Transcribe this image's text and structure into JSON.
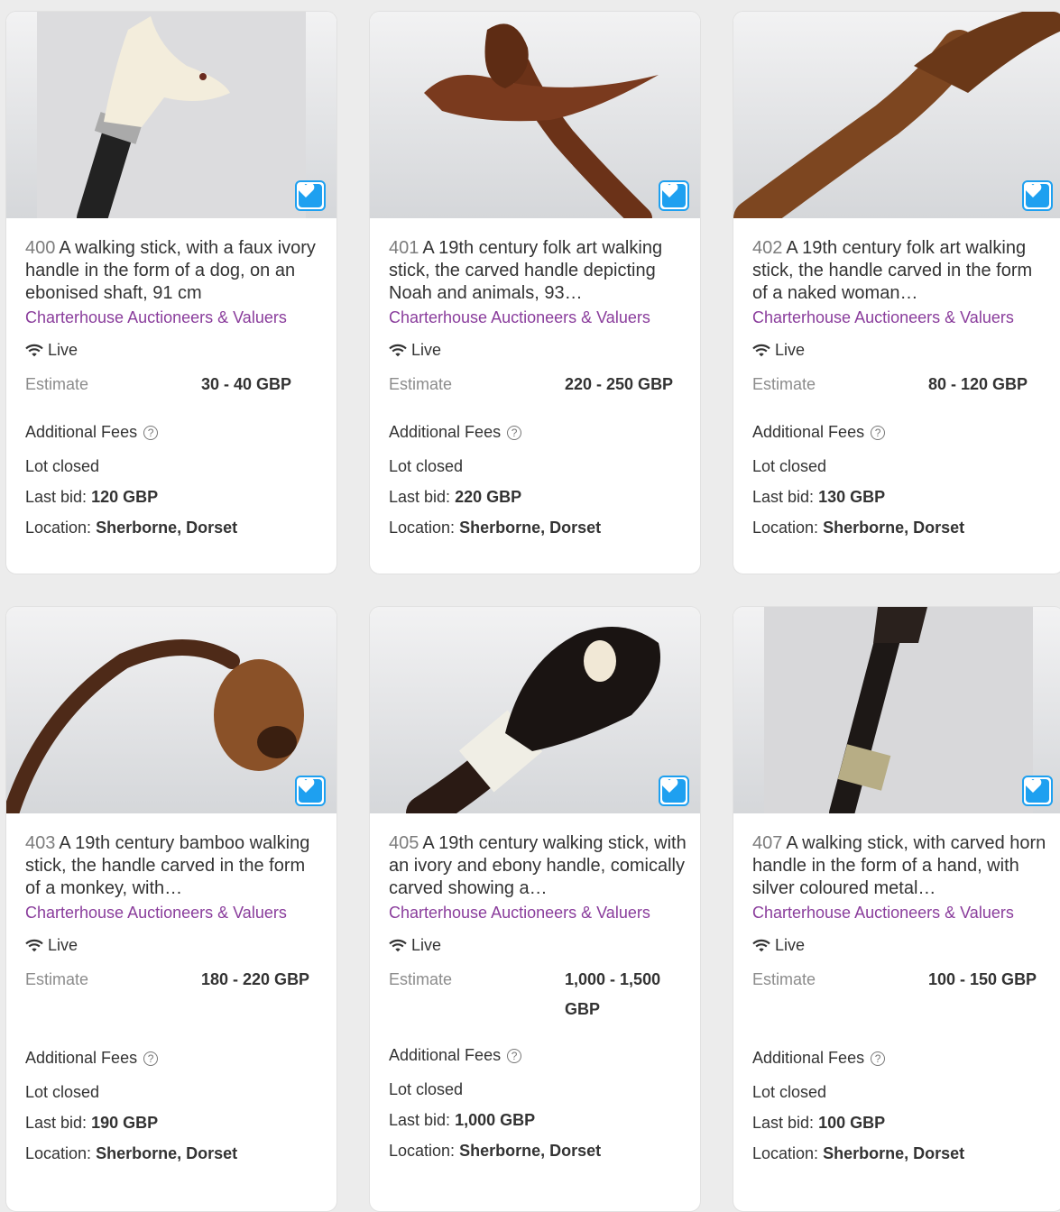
{
  "labels": {
    "live": "Live",
    "estimate": "Estimate",
    "additional_fees": "Additional Fees",
    "lot_closed": "Lot closed",
    "last_bid_prefix": "Last bid:",
    "location_prefix": "Location:"
  },
  "colors": {
    "favorite": "#1ea0f0",
    "auction_house": "#8a3d9c"
  },
  "lots": [
    {
      "lot": "400",
      "title": "A walking stick, with a faux ivory handle in the form of a dog, on an ebonised shaft, 91 cm",
      "house": "Charterhouse Auctioneers & Valuers",
      "estimate": "30 - 40 GBP",
      "last_bid": "120 GBP",
      "location": "Sherborne, Dorset",
      "favorite_icon": "heart-icon"
    },
    {
      "lot": "401",
      "title": "A 19th century folk art walking stick, the carved handle depicting Noah and animals, 93…",
      "house": "Charterhouse Auctioneers & Valuers",
      "estimate": "220 - 250 GBP",
      "last_bid": "220 GBP",
      "location": "Sherborne, Dorset",
      "favorite_icon": "heart-icon"
    },
    {
      "lot": "402",
      "title": "A 19th century folk art walking stick, the handle carved in the form of a naked woman…",
      "house": "Charterhouse Auctioneers & Valuers",
      "estimate": "80 - 120 GBP",
      "last_bid": "130 GBP",
      "location": "Sherborne, Dorset",
      "favorite_icon": "heart-icon"
    },
    {
      "lot": "403",
      "title": "A 19th century bamboo walking stick, the handle carved in the form of a monkey, with…",
      "house": "Charterhouse Auctioneers & Valuers",
      "estimate": "180 - 220 GBP",
      "last_bid": "190 GBP",
      "location": "Sherborne, Dorset",
      "favorite_icon": "heart-icon"
    },
    {
      "lot": "405",
      "title": "A 19th century walking stick, with an ivory and ebony handle, comically carved showing a…",
      "house": "Charterhouse Auctioneers & Valuers",
      "estimate": "1,000 - 1,500 GBP",
      "last_bid": "1,000 GBP",
      "location": "Sherborne, Dorset",
      "favorite_icon": "heart-icon"
    },
    {
      "lot": "407",
      "title": "A walking stick, with carved horn handle in the form of a hand, with silver coloured metal…",
      "house": "Charterhouse Auctioneers & Valuers",
      "estimate": "100 - 150 GBP",
      "last_bid": "100 GBP",
      "location": "Sherborne, Dorset",
      "favorite_icon": "heart-icon"
    }
  ]
}
